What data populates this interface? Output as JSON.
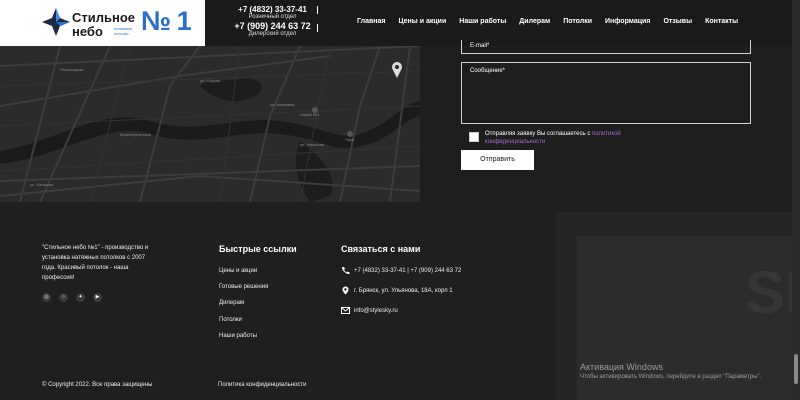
{
  "header": {
    "logo": {
      "line1": "Стильное",
      "line2": "небо",
      "tagline": "натяжные потолки",
      "number": "№ 1"
    },
    "phones": [
      {
        "number": "+7 (4832) 33-37-41",
        "dept": "Розничный отдел"
      },
      {
        "number": "+7 (909) 244 63 72",
        "dept": "Дилерский отдел"
      }
    ],
    "nav": [
      "Главная",
      "Цены и акции",
      "Наши работы",
      "Дилерам",
      "Потолки",
      "Информация",
      "Отзывы",
      "Контакты"
    ]
  },
  "map": {
    "labels": {
      "ul_sedova": "ул. Седова",
      "ul_peshekhodnaya": "Пешеходная",
      "ul_kalinina": "ул. Калинина",
      "ul_ulyanova": "ул. Ульянова",
      "ul_krasnoflotskaya": "Краснофлотская",
      "litsey": "Лицей №1",
      "bolshaya": "ул. Большая",
      "park": "Парк"
    }
  },
  "form": {
    "email_placeholder": "E-mail*",
    "message_placeholder": "Сообщение*",
    "consent_text": "Отправляя заявку Вы соглашаетесь с ",
    "consent_link": "политикой конфиденциальности",
    "submit_label": "Отправить"
  },
  "footer": {
    "about": "\"Стильное небо №1\" - производство и установка натяжных потолков с 2007 года. Красивый потолок - наша профессия!",
    "socials": [
      "instagram-icon",
      "odnoklassniki-icon",
      "twitter-icon",
      "youtube-icon"
    ],
    "quick_links_title": "Быстрые ссылки",
    "quick_links": [
      "Цены и акции",
      "Готовые решения",
      "Дилерам",
      "Потолки",
      "Наши работы"
    ],
    "contact_title": "Связаться с нами",
    "contacts": {
      "phone": "+7 (4832) 33-37-41 | +7 (909) 244 63 72",
      "address": "г. Брянск, ул. Ульянова, 18А, корп 1",
      "email": "info@stylesky.ru"
    },
    "copyright": "© Copyright 2022. Все права защищены",
    "privacy": "Политика конфиденциальности",
    "watermark": "SM"
  },
  "os_overlay": {
    "title": "Активация Windows",
    "subtitle": "Чтобы активировать Windows, перейдите в раздел \"Параметры\"."
  },
  "colors": {
    "accent": "#2a6fd0",
    "link": "#a46bd0",
    "bg": "#1e1e1e"
  }
}
